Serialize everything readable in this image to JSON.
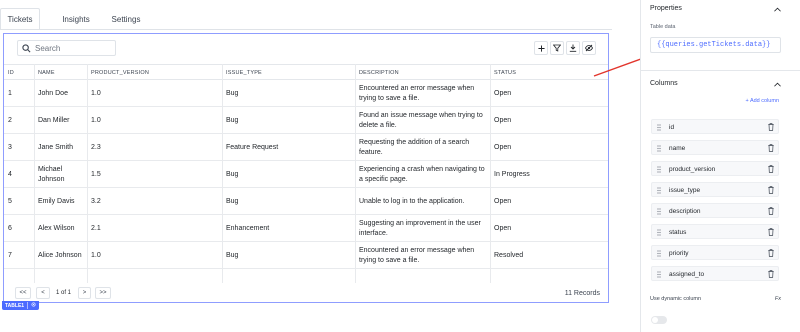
{
  "tabs": [
    {
      "label": "Tickets",
      "active": true
    },
    {
      "label": "Insights",
      "active": false
    },
    {
      "label": "Settings",
      "active": false
    }
  ],
  "table": {
    "widget_tag": "TABLE1",
    "search": {
      "placeholder": "Search",
      "value": ""
    },
    "toolbar_icons": [
      "plus-icon",
      "filter-icon",
      "download-icon",
      "eye-off-icon"
    ],
    "columns": [
      "ID",
      "NAME",
      "PRODUCT_VERSION",
      "ISSUE_TYPE",
      "DESCRIPTION",
      "STATUS"
    ],
    "rows": [
      [
        "1",
        "John Doe",
        "1.0",
        "Bug",
        "Encountered an error message when trying to save a file.",
        "Open"
      ],
      [
        "2",
        "Dan Miller",
        "1.0",
        "Bug",
        "Found an issue message when trying to delete a file.",
        "Open"
      ],
      [
        "3",
        "Jane Smith",
        "2.3",
        "Feature Request",
        "Requesting the addition of a search feature.",
        "Open"
      ],
      [
        "4",
        "Michael Johnson",
        "1.5",
        "Bug",
        "Experiencing a crash when navigating to a specific page.",
        "In Progress"
      ],
      [
        "5",
        "Emily Davis",
        "3.2",
        "Bug",
        "Unable to log in to the application.",
        "Open"
      ],
      [
        "6",
        "Alex Wilson",
        "2.1",
        "Enhancement",
        "Suggesting an improvement in the user interface.",
        "Open"
      ],
      [
        "7",
        "Alice Johnson",
        "1.0",
        "Bug",
        "Encountered an error message when trying to save a file.",
        "Resolved"
      ]
    ],
    "pagination": {
      "first": "<<",
      "prev": "<",
      "page": "1 of 1",
      "next": ">",
      "last": ">>"
    },
    "records": "11 Records"
  },
  "properties": {
    "title": "Properties",
    "table_data_label": "Table data",
    "table_data_value": "{{queries.getTickets.data}}"
  },
  "columns_panel": {
    "title": "Columns",
    "add_label": "+ Add column",
    "items": [
      "id",
      "name",
      "product_version",
      "issue_type",
      "description",
      "status",
      "priority",
      "assigned_to"
    ],
    "dynamic_label": "Use dynamic column",
    "fx_label": "Fx",
    "dynamic_enabled": false
  },
  "colors": {
    "accent": "#4c6bff",
    "arrow": "#e2352c",
    "selection_border": "#8f9dff"
  }
}
